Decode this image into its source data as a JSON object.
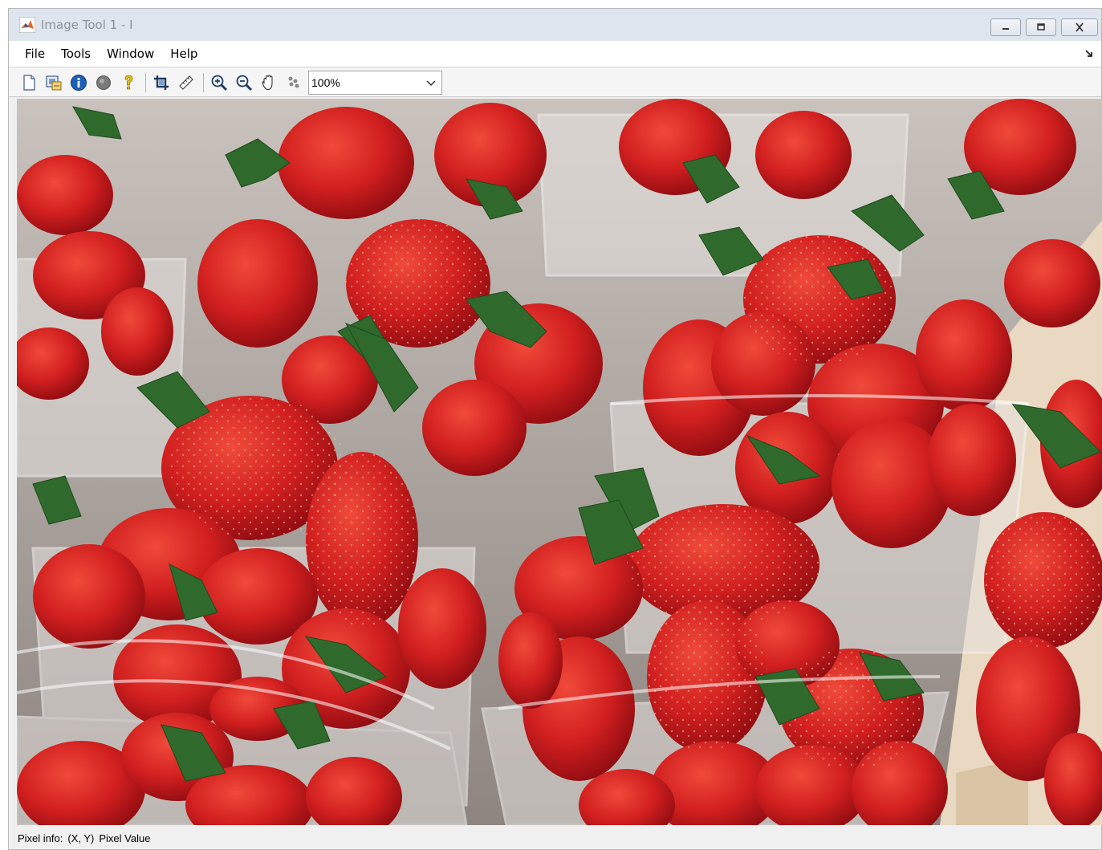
{
  "window": {
    "title": "Image Tool 1 - I",
    "controls": {
      "minimize": "minimize",
      "restore": "restore",
      "close": "close"
    }
  },
  "menu": {
    "items": [
      "File",
      "Tools",
      "Window",
      "Help"
    ]
  },
  "toolbar": {
    "buttons": [
      {
        "icon": "new-figure-icon"
      },
      {
        "icon": "export-icon"
      },
      {
        "icon": "image-info-icon"
      },
      {
        "icon": "adjust-contrast-icon"
      },
      {
        "icon": "help-icon"
      },
      {
        "icon": "crop-icon"
      },
      {
        "icon": "measure-distance-icon"
      },
      {
        "icon": "zoom-in-icon"
      },
      {
        "icon": "zoom-out-icon"
      },
      {
        "icon": "pan-icon"
      },
      {
        "icon": "overview-icon"
      }
    ],
    "zoom": "100%"
  },
  "image": {
    "subject": "strawberries in plastic containers",
    "colors": {
      "berry": "#d11f1f",
      "berry_dark": "#9c0e12",
      "leaf": "#2f6a2c",
      "tray": "#cfc8c4",
      "background": "#b3a7a0"
    }
  },
  "status": {
    "label": "Pixel info:",
    "coords": "(X, Y)",
    "value": "Pixel Value"
  }
}
